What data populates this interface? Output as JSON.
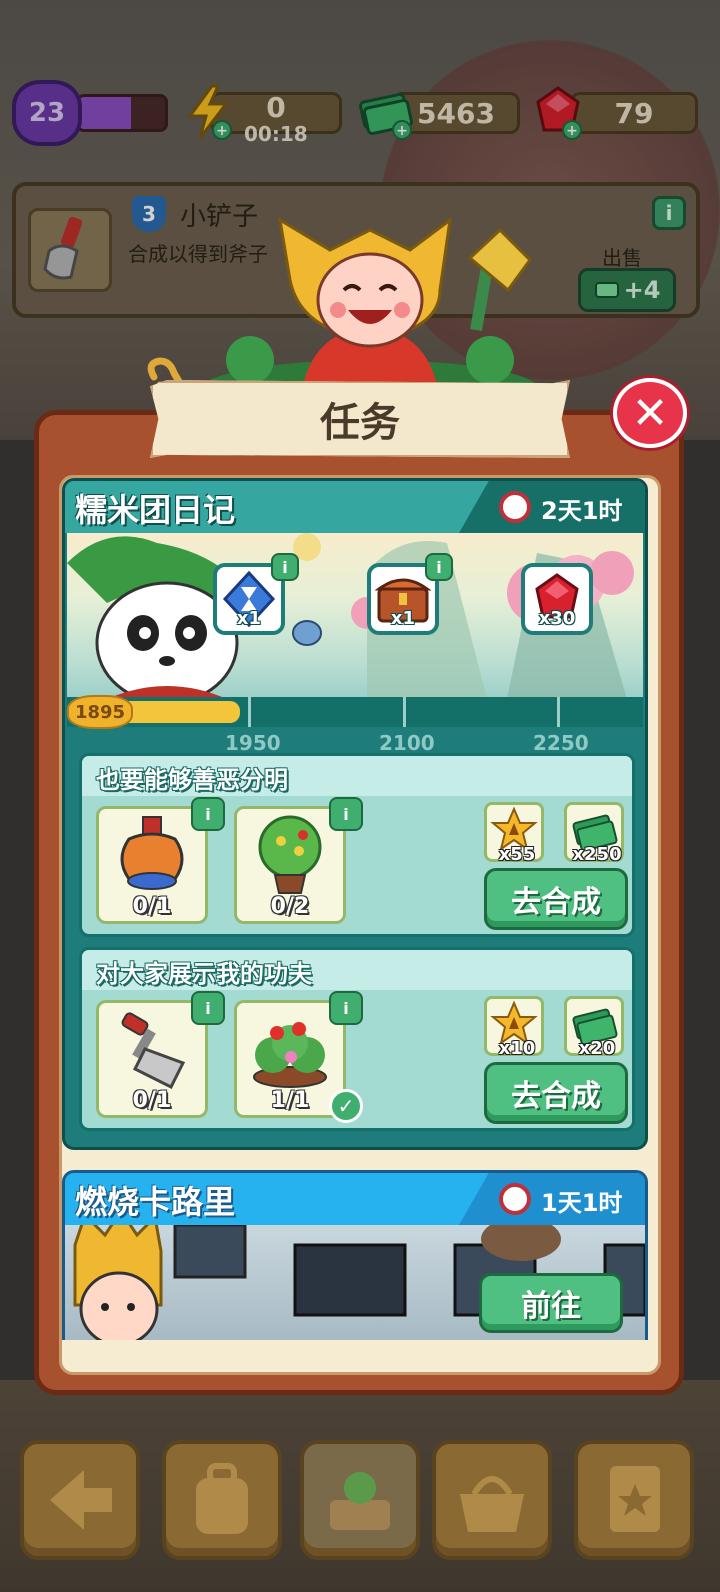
{
  "hud": {
    "level": "23",
    "level_progress": 0.6,
    "energy": "0",
    "energy_timer": "00:18",
    "cash": "5463",
    "gems": "79"
  },
  "item_info": {
    "level": "3",
    "name": "小铲子",
    "description": "合成以得到斧子",
    "sell_label": "出售",
    "sell_value": "+4"
  },
  "panel": {
    "title": "任务"
  },
  "event1": {
    "title": "糯米团日记",
    "time_left": "2天1时",
    "current_points": "1895",
    "progress_fraction": 0.3,
    "milestones": [
      {
        "points": "1950",
        "qty": "x1",
        "icon": "hourglass-gem-icon"
      },
      {
        "points": "2100",
        "qty": "x1",
        "icon": "treasure-chest-icon"
      },
      {
        "points": "2250",
        "qty": "x30",
        "icon": "ruby-gem-icon"
      }
    ],
    "tasks": [
      {
        "title": "也要能够善恶分明",
        "requirements": [
          {
            "count": "0/1",
            "icon": "ornate-vase-icon"
          },
          {
            "count": "0/2",
            "icon": "potted-tree-icon"
          }
        ],
        "rewards": [
          {
            "qty": "x55",
            "icon": "xp-star-icon"
          },
          {
            "qty": "x250",
            "icon": "cash-stack-icon"
          }
        ],
        "button": "去合成"
      },
      {
        "title": "对大家展示我的功夫",
        "requirements": [
          {
            "count": "0/1",
            "icon": "garden-rake-icon"
          },
          {
            "count": "1/1",
            "icon": "flower-bush-icon",
            "done": true
          }
        ],
        "rewards": [
          {
            "qty": "x10",
            "icon": "xp-star-icon"
          },
          {
            "qty": "x20",
            "icon": "cash-stack-icon"
          }
        ],
        "button": "去合成"
      }
    ]
  },
  "event2": {
    "title": "燃烧卡路里",
    "time_left": "1天1时",
    "button": "前往"
  }
}
